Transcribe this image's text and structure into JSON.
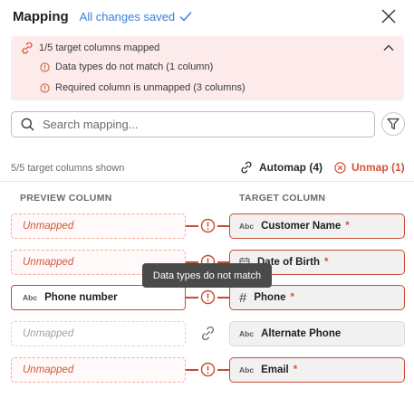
{
  "header": {
    "title": "Mapping",
    "saved_status": "All changes saved"
  },
  "alert": {
    "summary": "1/5 target columns mapped",
    "issues": [
      "Data types do not match (1 column)",
      "Required column is unmapped (3 columns)"
    ]
  },
  "search": {
    "placeholder": "Search mapping..."
  },
  "toolbar": {
    "shown_count": "5/5 target columns shown",
    "automap_label": "Automap (4)",
    "unmap_label": "Unmap (1)"
  },
  "columns": {
    "preview_header": "PREVIEW COLUMN",
    "target_header": "TARGET COLUMN"
  },
  "rows": [
    {
      "source": "Unmapped",
      "source_state": "unmapped",
      "source_type": "",
      "connector": "warning",
      "target": "Customer Name",
      "target_type": "Abc",
      "required": "*",
      "target_state": "error"
    },
    {
      "source": "Unmapped",
      "source_state": "unmapped",
      "source_type": "",
      "connector": "warning",
      "target": "Date of Birth",
      "target_type": "calendar",
      "required": "*",
      "target_state": "error"
    },
    {
      "source": "Phone number",
      "source_state": "mapped",
      "source_type": "Abc",
      "connector": "warning",
      "target": "Phone",
      "target_type": "#",
      "required": "*",
      "target_state": "error"
    },
    {
      "source": "Unmapped",
      "source_state": "optional",
      "source_type": "",
      "connector": "link",
      "target": "Alternate Phone",
      "target_type": "Abc",
      "required": "",
      "target_state": "ok"
    },
    {
      "source": "Unmapped",
      "source_state": "unmapped",
      "source_type": "",
      "connector": "warning",
      "target": "Email",
      "target_type": "Abc",
      "required": "*",
      "target_state": "error"
    }
  ],
  "tooltip": {
    "text": "Data types do not match"
  },
  "colors": {
    "accent_blue": "#3b7dd8",
    "error_red": "#c94a33",
    "alert_bg": "#fcebea"
  }
}
